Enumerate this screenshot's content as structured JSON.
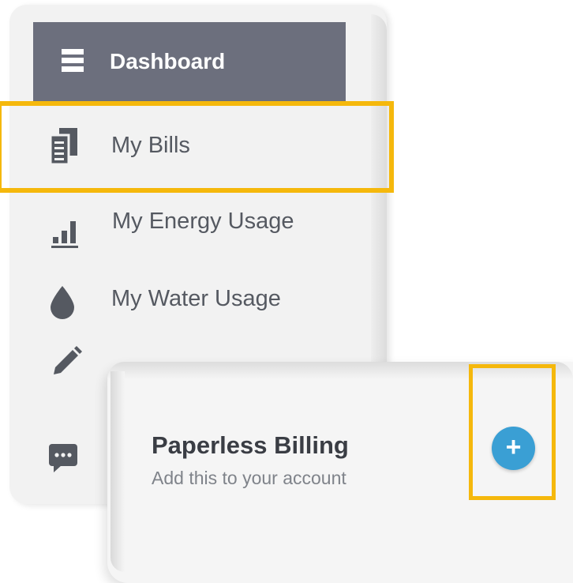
{
  "sidebar": {
    "items": [
      {
        "label": "Dashboard",
        "icon": "menu-icon"
      },
      {
        "label": "My Bills",
        "icon": "bills-icon"
      },
      {
        "label": "My Energy Usage",
        "icon": "bar-chart-icon"
      },
      {
        "label": "My Water Usage",
        "icon": "water-drop-icon"
      },
      {
        "label": "",
        "icon": "pencil-icon"
      },
      {
        "label": "",
        "icon": "chat-icon"
      }
    ]
  },
  "card": {
    "title": "Paperless Billing",
    "subtitle": "Add this to your account",
    "add_button_label": "+"
  },
  "colors": {
    "dashboard_bg": "#6c6f7d",
    "highlight": "#f5b80c",
    "add_button": "#3a9fd4"
  }
}
